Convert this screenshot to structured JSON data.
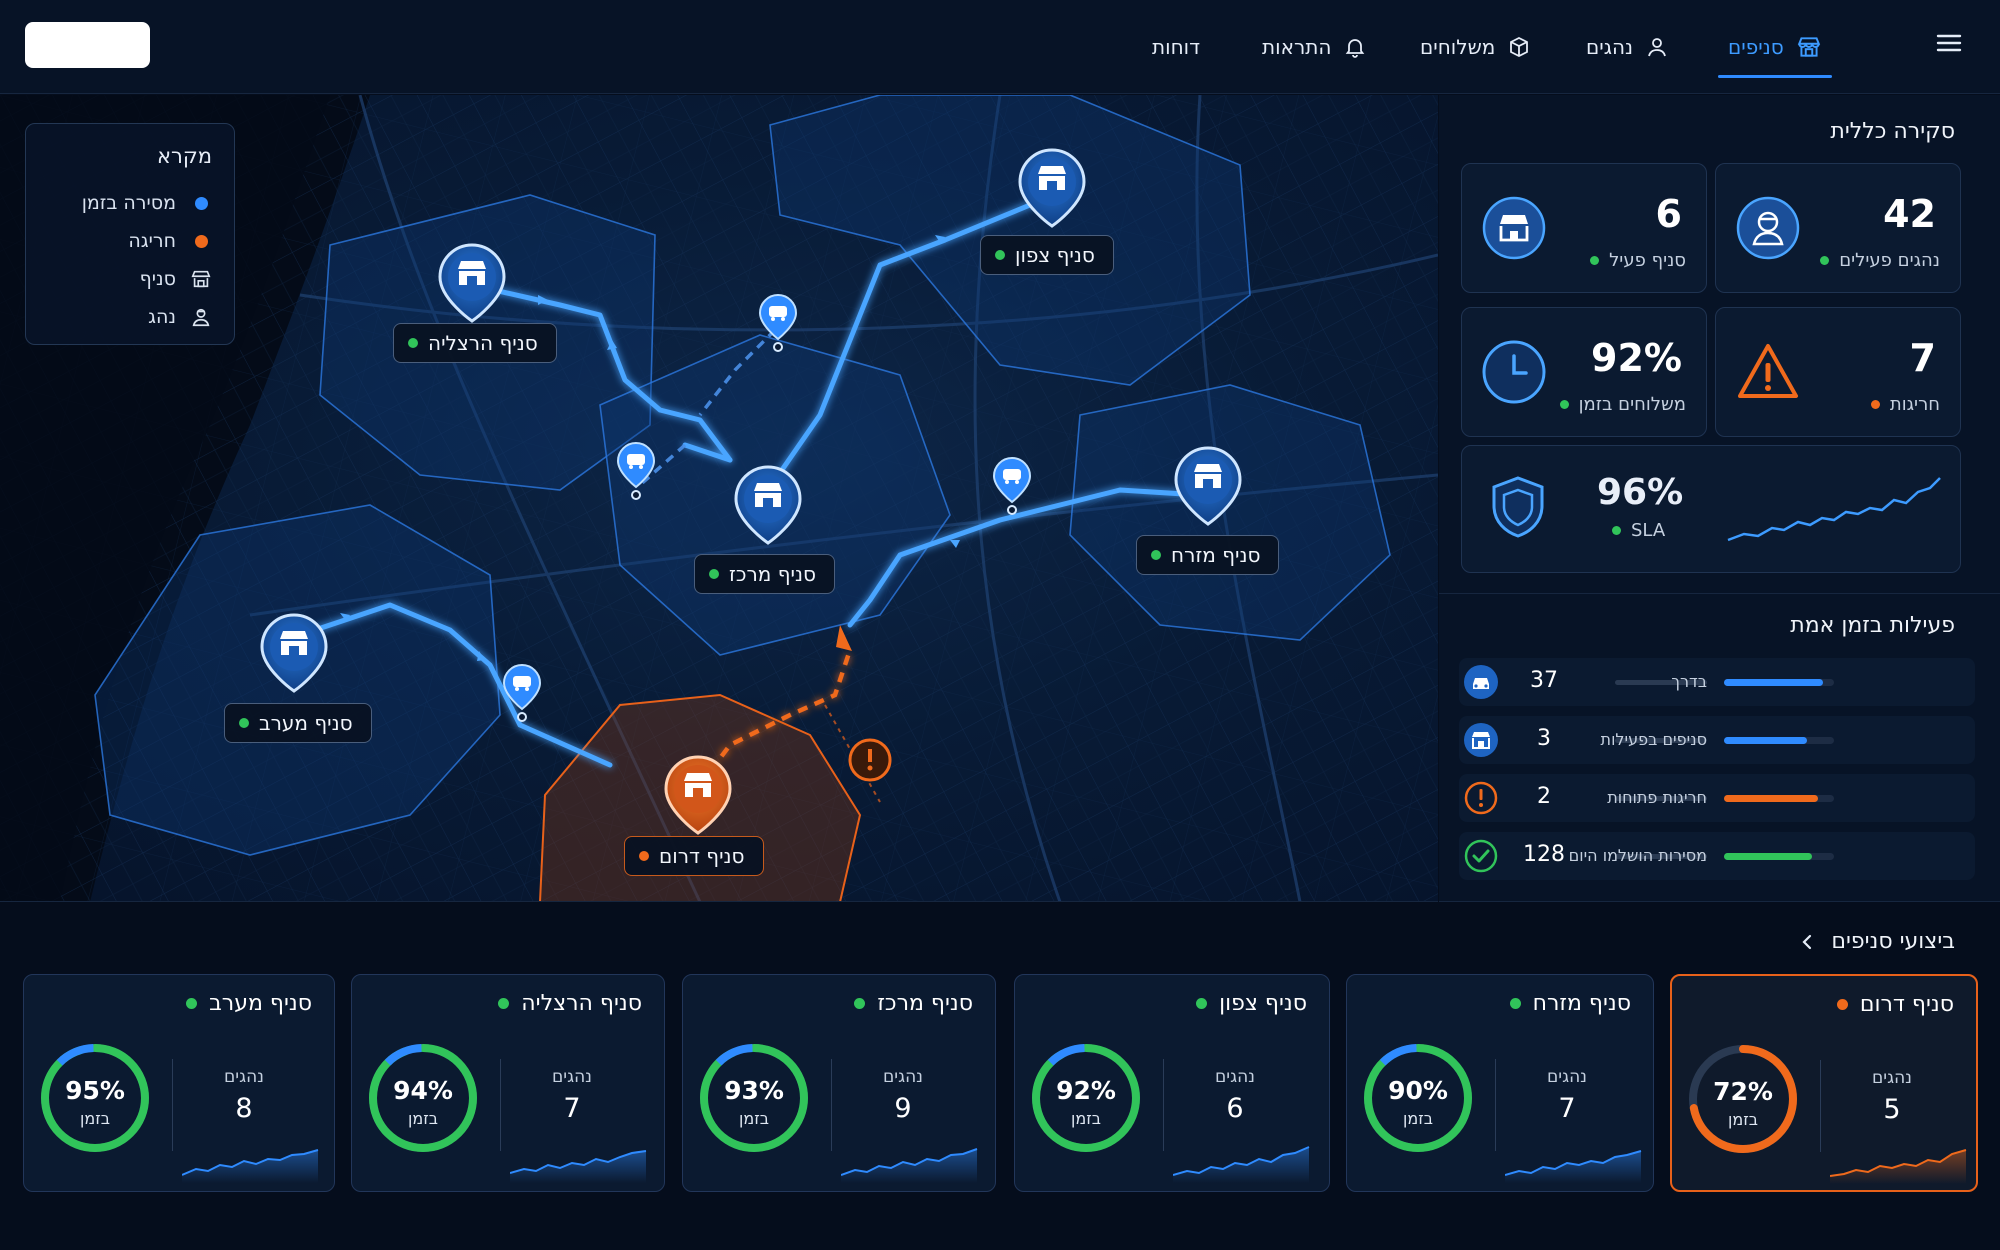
{
  "nav": {
    "items": [
      {
        "label": "סניפים",
        "icon": "store-icon",
        "active": true
      },
      {
        "label": "נהגים",
        "icon": "user-icon",
        "active": false
      },
      {
        "label": "משלוחים",
        "icon": "box-icon",
        "active": false
      },
      {
        "label": "התראות",
        "icon": "bell-icon",
        "active": false
      },
      {
        "label": "דוחות",
        "icon": "",
        "active": false
      }
    ]
  },
  "legend": {
    "title": "מקרא",
    "items": [
      {
        "label": "מסירה בזמן",
        "icon": "blue-dot",
        "color": "#2f8bff"
      },
      {
        "label": "חריגה",
        "icon": "orange-dot",
        "color": "#f06a1c"
      },
      {
        "label": "סניף",
        "icon": "store-icon"
      },
      {
        "label": "נהג",
        "icon": "driver-icon"
      }
    ]
  },
  "map": {
    "branches": [
      {
        "name": "סניף צפון",
        "status": "ok"
      },
      {
        "name": "סניף הרצליה",
        "status": "ok"
      },
      {
        "name": "סניף מרכז",
        "status": "ok"
      },
      {
        "name": "סניף מזרח",
        "status": "ok"
      },
      {
        "name": "סניף מערב",
        "status": "ok"
      },
      {
        "name": "סניף דרום",
        "status": "alert"
      }
    ]
  },
  "overview": {
    "title": "סקירה כללית",
    "cards": [
      {
        "value": "6",
        "label": "סניף פעיל",
        "icon": "store-icon",
        "status_color": "#31c45a"
      },
      {
        "value": "42",
        "label": "נהגים פעילים",
        "icon": "driver-icon",
        "status_color": "#31c45a"
      },
      {
        "value": "92%",
        "label": "משלוחים בזמן",
        "icon": "clock-icon",
        "status_color": "#31c45a"
      },
      {
        "value": "7",
        "label": "חריגות",
        "icon": "warning-icon",
        "status_color": "#f06a1c"
      }
    ],
    "sla": {
      "value": "96%",
      "label": "SLA",
      "icon": "shield-icon"
    }
  },
  "realtime": {
    "title": "פעילות בזמן אמת",
    "rows": [
      {
        "value": "37",
        "label": "בדרך",
        "icon": "car-icon",
        "fill": 0.9,
        "color": "#2f8bff"
      },
      {
        "value": "3",
        "label": "סניפים בפעילות",
        "icon": "store-icon",
        "fill": 0.75,
        "color": "#2f8bff"
      },
      {
        "value": "2",
        "label": "חריגות פתוחות",
        "icon": "alert-icon",
        "fill": 0.85,
        "color": "#f06a1c"
      },
      {
        "value": "128",
        "label": "מסירות הושלמו היום",
        "icon": "check-icon",
        "fill": 0.8,
        "color": "#31c45a"
      }
    ]
  },
  "performance": {
    "title": "ביצועי סניפים",
    "drivers_label": "נהגים",
    "ontime_label": "בזמן",
    "cards": [
      {
        "name": "סניף דרום",
        "pct": "72%",
        "pct_value": 0.72,
        "drivers": "5",
        "status": "alert"
      },
      {
        "name": "סניף מזרח",
        "pct": "90%",
        "pct_value": 0.9,
        "drivers": "7",
        "status": "ok"
      },
      {
        "name": "סניף צפון",
        "pct": "92%",
        "pct_value": 0.92,
        "drivers": "6",
        "status": "ok"
      },
      {
        "name": "סניף מרכז",
        "pct": "93%",
        "pct_value": 0.93,
        "drivers": "9",
        "status": "ok"
      },
      {
        "name": "סניף הרצליה",
        "pct": "94%",
        "pct_value": 0.94,
        "drivers": "7",
        "status": "ok"
      },
      {
        "name": "סניף מערב",
        "pct": "95%",
        "pct_value": 0.95,
        "drivers": "8",
        "status": "ok"
      }
    ]
  },
  "colors": {
    "accent": "#2f8bff",
    "ok": "#31c45a",
    "alert": "#f06a1c"
  }
}
